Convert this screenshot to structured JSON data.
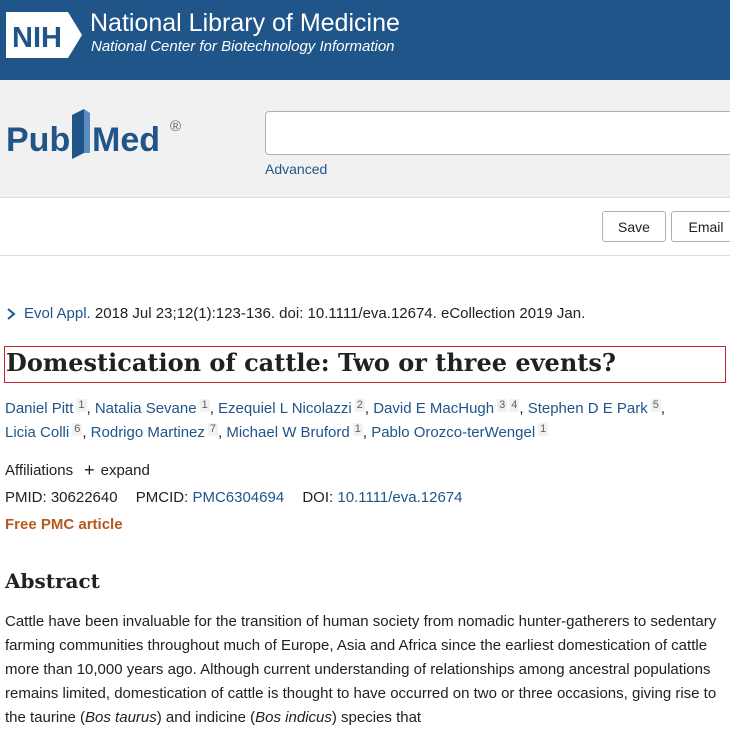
{
  "header": {
    "nih_badge": "NIH",
    "org_title": "National Library of Medicine",
    "org_subtitle": "National Center for Biotechnology Information",
    "bar_color": "#20558a"
  },
  "search": {
    "logo_text_left": "Pub",
    "logo_text_right": "Med",
    "logo_mark": "®",
    "query_value": "",
    "advanced_label": "Advanced"
  },
  "actions": {
    "save_label": "Save",
    "email_label": "Email"
  },
  "article": {
    "journal": "Evol Appl.",
    "citation_rest": " 2018 Jul 23;12(1):123-136. doi: 10.1111/eva.12674. eCollection 2019 Jan.",
    "title": "Domestication of cattle: Two or three events?",
    "authors": [
      {
        "name": "Daniel Pitt",
        "affs": [
          "1"
        ]
      },
      {
        "name": "Natalia Sevane",
        "affs": [
          "1"
        ]
      },
      {
        "name": "Ezequiel L Nicolazzi",
        "affs": [
          "2"
        ]
      },
      {
        "name": "David E MacHugh",
        "affs": [
          "3",
          "4"
        ]
      },
      {
        "name": "Stephen D E Park",
        "affs": [
          "5"
        ]
      },
      {
        "name": "Licia Colli",
        "affs": [
          "6"
        ]
      },
      {
        "name": "Rodrigo Martinez",
        "affs": [
          "7"
        ]
      },
      {
        "name": "Michael W Bruford",
        "affs": [
          "1"
        ]
      },
      {
        "name": "Pablo Orozco-terWengel",
        "affs": [
          "1"
        ]
      }
    ],
    "affiliations_label": "Affiliations",
    "expand_label": "expand",
    "pmid_label": "PMID:",
    "pmid_value": "30622640",
    "pmcid_label": "PMCID:",
    "pmcid_value": "PMC6304694",
    "doi_label": "DOI:",
    "doi_value": "10.1111/eva.12674",
    "free_pmc_label": "Free PMC article",
    "abstract_heading": "Abstract",
    "abstract_text_1": "Cattle have been invaluable for the transition of human society from nomadic hunter-gatherers to sedentary farming communities throughout much of Europe, Asia and Africa since the earliest domestication of cattle more than 10,000 years ago. Although current understanding of relationships among ancestral populations remains limited, domestication of cattle is thought to have occurred on two or three occasions, giving rise to the taurine (",
    "abstract_italic_1": "Bos taurus",
    "abstract_text_2": ") and indicine (",
    "abstract_italic_2": "Bos indicus",
    "abstract_text_3": ") species that"
  }
}
